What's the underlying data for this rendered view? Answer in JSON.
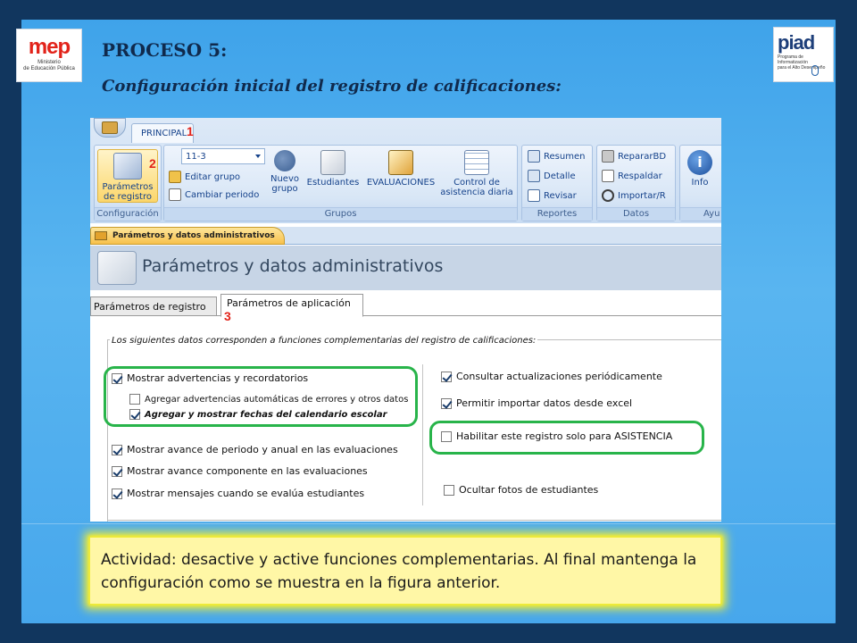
{
  "slide": {
    "title": "PROCESO 5:",
    "subtitle": "Configuración inicial del registro de calificaciones:",
    "logo_left": {
      "mark": "mep",
      "sub1": "Ministerio",
      "sub2": "de Educación Pública"
    },
    "logo_right": {
      "mark": "piad",
      "sub1": "Programa de Informatización",
      "sub2": "para el Alto Desempeño"
    },
    "activity_text": "Actividad: desactive y active funciones complementarias. Al final mantenga la configuración como se muestra en la figura anterior."
  },
  "ribbon": {
    "tab": "PRINCIPAL",
    "groups": {
      "configuracion": {
        "label": "Configuración",
        "button": "Parámetros de registro"
      },
      "grupos": {
        "label": "Grupos",
        "combo_value": "11-3",
        "editar": "Editar grupo",
        "cambiar": "Cambiar periodo",
        "nuevo": "Nuevo grupo",
        "estudiantes": "Estudiantes",
        "evaluaciones": "EVALUACIONES",
        "control": "Control de asistencia diaria"
      },
      "reportes": {
        "label": "Reportes",
        "resumen": "Resumen",
        "detalle": "Detalle",
        "revisar": "Revisar"
      },
      "datos": {
        "label": "Datos",
        "reparar": "RepararBD",
        "respaldar": "Respaldar",
        "importar": "Importar/R"
      },
      "ayuda": {
        "label": "Ayu",
        "info": "Info"
      }
    }
  },
  "document": {
    "tab": "Parámetros y datos administrativos",
    "header_title": "Parámetros y datos administrativos",
    "tabs": [
      "Parámetros de registro",
      "Parámetros de aplicación"
    ],
    "caption": "Los siguientes datos corresponden a funciones complementarias del registro de calificaciones:",
    "left_options": [
      {
        "label": "Mostrar advertencias y recordatorios",
        "checked": true
      },
      {
        "label": "Agregar advertencias automáticas de errores y otros datos",
        "checked": false
      },
      {
        "label": "Agregar y mostrar fechas del calendario escolar",
        "checked": true
      },
      {
        "label": "Mostrar avance de periodo y anual en las evaluaciones",
        "checked": true
      },
      {
        "label": "Mostrar avance componente en las evaluaciones",
        "checked": true
      },
      {
        "label": "Mostrar mensajes cuando se evalúa estudiantes",
        "checked": true
      }
    ],
    "right_options": [
      {
        "label": "Consultar actualizaciones periódicamente",
        "checked": true
      },
      {
        "label": "Permitir importar datos desde excel",
        "checked": true
      },
      {
        "label": "Habilitar este registro solo para ASISTENCIA",
        "checked": false
      },
      {
        "label": "Ocultar fotos de estudiantes",
        "checked": false
      }
    ]
  },
  "markers": [
    "1",
    "2",
    "3"
  ],
  "colors": {
    "highlight": "#28b44a",
    "marker": "#e2231a",
    "activity_bg": "#fff7a6"
  }
}
